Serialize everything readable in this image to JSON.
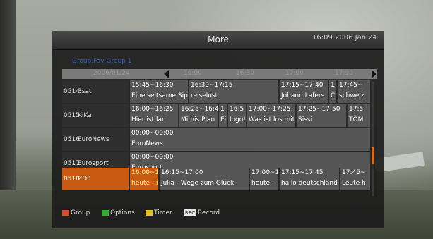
{
  "window": {
    "title": "More",
    "datetime": "16:09 2006 Jan 24"
  },
  "group_label": "Group:Fav Group 1",
  "timeline": {
    "date": "2006/01/24",
    "times": [
      "16:00",
      "16:30",
      "17:00",
      "17:30"
    ]
  },
  "channels": [
    {
      "num": "0514",
      "name": "3sat",
      "programs": [
        {
          "time": "15:45~16:30",
          "title": "Eine seltsame Sip"
        },
        {
          "time": "16:30~17:15",
          "title": "reiselust"
        },
        {
          "time": "17:15~17:40",
          "title": "Johann Lafers"
        },
        {
          "time": "1",
          "title": "C"
        },
        {
          "time": "17:45~",
          "title": "schweiz"
        }
      ]
    },
    {
      "num": "0515",
      "name": "KiKa",
      "programs": [
        {
          "time": "16:00~16:25",
          "title": "Hier ist lan"
        },
        {
          "time": "16:25~16:4",
          "title": "Mimis Plan"
        },
        {
          "time": "1",
          "title": "Ei"
        },
        {
          "time": "16:5",
          "title": "logo!"
        },
        {
          "time": "17:00~17:25",
          "title": "Was ist los mit"
        },
        {
          "time": "17:25~17:50",
          "title": "Sissi"
        },
        {
          "time": "17:5",
          "title": "TOM"
        }
      ]
    },
    {
      "num": "0516",
      "name": "EuroNews",
      "programs": [
        {
          "time": "00:00~00:00",
          "title": "EuroNews"
        }
      ]
    },
    {
      "num": "0517",
      "name": "Eurosport",
      "programs": [
        {
          "time": "00:00~00:00",
          "title": "Eurosport"
        }
      ]
    },
    {
      "num": "0518",
      "name": "ZDF",
      "selected": true,
      "programs": [
        {
          "time": "16:00~1",
          "title": "heute - i"
        },
        {
          "time": "16:15~17:00",
          "title": "Julia - Wege zum Glück"
        },
        {
          "time": "17:00~1",
          "title": "heute -"
        },
        {
          "time": "17:15~17:45",
          "title": "hallo deutschland"
        },
        {
          "time": "17:45~",
          "title": "Leute h"
        }
      ]
    }
  ],
  "footer": {
    "group": {
      "label": "Group",
      "color": "#e04a2a"
    },
    "options": {
      "label": "Options",
      "color": "#2fae2a"
    },
    "timer": {
      "label": "Timer",
      "color": "#e6c21e"
    },
    "record": {
      "label": "Record",
      "badge": "REC"
    }
  },
  "colors": {
    "selection": "#c85a12",
    "group_text": "#3b6ee0"
  }
}
